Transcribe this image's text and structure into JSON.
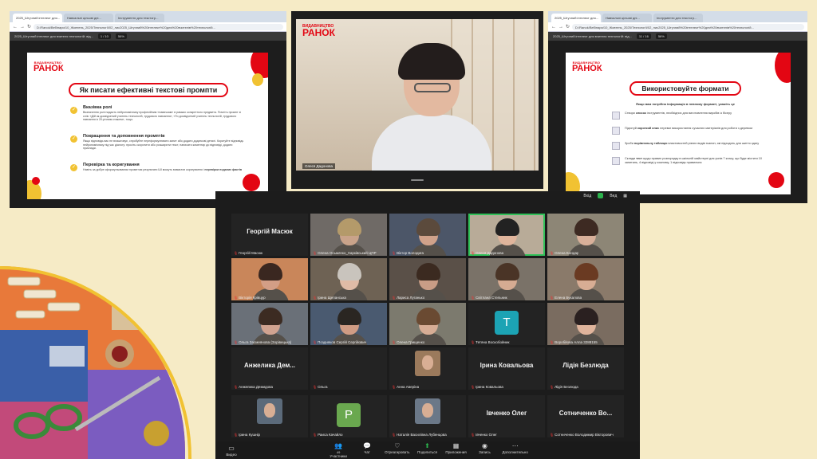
{
  "slide1": {
    "tabs": [
      "2025_Штучний інтелект для...",
      "Навчальні цільові дні...",
      "Інструменти для текстогр..."
    ],
    "url": "D:/Ranok/Вебінари/10_Жовтень_2025/Технології/02_лис2025_Штучний%20інтелект%20для%20вчителів%20технологій...",
    "pdf_title": "2025_Штучний інтелект для вчителя технологій: від...",
    "page": "1 / 10",
    "zoom": "56%",
    "logo_small": "ВИДАВНИЦТВО",
    "logo_big": "РАНОК",
    "title": "Як писати ефективні текстові промпти",
    "sections": [
      {
        "title": "Вказівка ролі",
        "text": "Визначення ролі надасть нейропомічнику професійним «навичкам» в рамках конкретного предмета. Почніть промпт зі слів: «Дій як досвідчений учитель технологій, трудового навчання», «Ти досвідчений учитель технологій, трудового навчання із 20-річним стажем», тощо."
      },
      {
        "title": "Покращення та доповнення промптів",
        "text": "Якщо відповідь вас не влаштовує, спробуйте переформулювати запит або додати додаткові деталі. Коригуйте відповідь нейропомічнику під час діалогу: просіть скоротити або розширити текст, написати коментар до відповіді, додати приклади."
      },
      {
        "title": "Перевірка та коригування",
        "text": "Навіть за добре сформульованим промптом результати ШІ можуть вимагати коригування і",
        "text_bold": "перевірки поданих фактів"
      }
    ]
  },
  "video": {
    "logo_small": "ВИДАВНИЦТВО",
    "logo_big": "РАНОК",
    "speaker": "Олеся Дадонова"
  },
  "slide3": {
    "tabs": [
      "2025_Штучний інтелект для...",
      "Навчальні цільові дні...",
      "Інструменти для текстогр..."
    ],
    "url": "D:/Ranok/Вебінари/10_Жовтень_2025/Технології/02_лис2025_Штучний%20інтелект%20для%20вчителів%20технологій...",
    "pdf_title": "2025_Штучний інтелект для вчителя технологій: від...",
    "page": "11 / 16",
    "zoom": "56%",
    "logo_small": "ВИДАВНИЦТВО",
    "logo_big": "РАНОК",
    "title": "Використовуйте формати",
    "subtitle": "Якщо вам потрібна інформація в певному форматі, укажіть це",
    "rows": [
      {
        "pre": "Створи ",
        "bold": "список",
        "post": " інструментів, необхідних для виготовлення виробів із бісеру"
      },
      {
        "pre": "Підготуй ",
        "bold": "короткий опис",
        "post": " переваг використання сучасних матеріалів для роботи з деревом"
      },
      {
        "pre": "Зроби ",
        "bold": "порівняльну таблицю",
        "post": " властивостей різних видів тканин, які підходять для шиття одягу"
      },
      {
        "pre": "Склади ",
        "bold": "тест",
        "post": " щодо правил розпорядку в шкільній майстерні для учнів 7 класу, що буде містити 10 запитань, 4 відповіді у кожному, 1 відповідь правильна"
      }
    ]
  },
  "zoom": {
    "top_controls": [
      "Вхід",
      "Вид"
    ],
    "host_name": "Георгій Масюк",
    "participants": [
      {
        "label": "Георгій Масюк",
        "type": "name",
        "big": "Георгій Масюк"
      },
      {
        "label": "Олена Осьмачко_Харківський ЦПР",
        "type": "video",
        "bg": "#6f6a66",
        "face": "#c9a38a",
        "hair": "#b49a6a"
      },
      {
        "label": "Віктор Володига",
        "type": "video",
        "bg": "#4c5668",
        "face": "#d0a28a",
        "hair": "#5b4a3c"
      },
      {
        "label": "Олеся Дадонова",
        "type": "video",
        "bg": "#b8ab98",
        "face": "#e0b59c",
        "hair": "#222",
        "active": true
      },
      {
        "label": "Олена Бондар",
        "type": "video",
        "bg": "#8d8676",
        "face": "#d8b09a",
        "hair": "#3d2a22"
      },
      {
        "label": "Вікторія Крівцур",
        "type": "video",
        "bg": "#c9865a",
        "face": "#d39e86",
        "hair": "#3a2720"
      },
      {
        "label": "Ірина Щепанська",
        "type": "video",
        "bg": "#6e6254",
        "face": "#e0bba6",
        "hair": "#c9c4bd"
      },
      {
        "label": "Лариса Луганько",
        "type": "video",
        "bg": "#5a5048",
        "face": "#c99d86",
        "hair": "#3b2a20"
      },
      {
        "label": "Світлана Стельник",
        "type": "video",
        "bg": "#7a7268",
        "face": "#d5ab92",
        "hair": "#4a3426"
      },
      {
        "label": "Елена Букалова",
        "type": "video",
        "bg": "#8a7a6a",
        "face": "#d8ad94",
        "hair": "#6a3a22"
      },
      {
        "label": "Ольга Засмеянова (Зорівецька)",
        "type": "video",
        "bg": "#6a7078",
        "face": "#d1a390",
        "hair": "#3c2b22"
      },
      {
        "label": "Поздняков Сергій Сергійович",
        "type": "video",
        "bg": "#4a5a70",
        "face": "#d09c84",
        "hair": "#2a2622"
      },
      {
        "label": "Олена Грищенко",
        "type": "video",
        "bg": "#7c7a6e",
        "face": "#d7ad95",
        "hair": "#6a4a32"
      },
      {
        "label": "Тетяна Воскобойник",
        "type": "avatar",
        "letter": "T",
        "color": "#1ca3b4"
      },
      {
        "label": "Воробйова Алла 3288155",
        "type": "video",
        "bg": "#7a6c60",
        "face": "#e0b49c",
        "hair": "#2a2020"
      },
      {
        "label": "Анжелика Демидова",
        "type": "name",
        "big": "Анжелика Дем..."
      },
      {
        "label": "Ольга",
        "type": "blank"
      },
      {
        "label": "Анна Аверіна",
        "type": "photo",
        "photo": "#9b7a5c"
      },
      {
        "label": "Ірина Ковальова",
        "type": "name",
        "big": "Ірина Ковальова"
      },
      {
        "label": "Лідія Безлюда",
        "type": "name",
        "big": "Лідія Безлюда"
      },
      {
        "label": "Ірина Кушнір",
        "type": "photo",
        "photo": "#5b6a7a"
      },
      {
        "label": "Раиса Качайло",
        "type": "avatar",
        "letter": "P",
        "color": "#6aa84f"
      },
      {
        "label": "Наталія Василівна Лубенцова",
        "type": "photo",
        "photo": "#6b7888"
      },
      {
        "label": "Івченко Олег",
        "type": "name",
        "big": "Івченко Олег"
      },
      {
        "label": "Сотниченко Володимир Вікторович",
        "type": "name",
        "big": "Сотниченко Во..."
      }
    ],
    "toolbar_left": [
      {
        "label": "Видео",
        "icon": "▭"
      }
    ],
    "toolbar_mid": [
      {
        "label": "Участники",
        "icon": "👥",
        "count": "49"
      },
      {
        "label": "Чат",
        "icon": "💬"
      },
      {
        "label": "Отреагировать",
        "icon": "♡"
      },
      {
        "label": "Поделиться",
        "icon": "⬆",
        "green": true
      },
      {
        "label": "Приложения",
        "icon": "▦"
      },
      {
        "label": "Запись",
        "icon": "◉"
      },
      {
        "label": "Дополнительно",
        "icon": "⋯"
      }
    ]
  },
  "colors": {
    "page_bg": "#f6ebc6",
    "brand_red": "#e30613",
    "accent_yellow": "#f1c232",
    "zoom_bg": "#1c1c1c"
  }
}
